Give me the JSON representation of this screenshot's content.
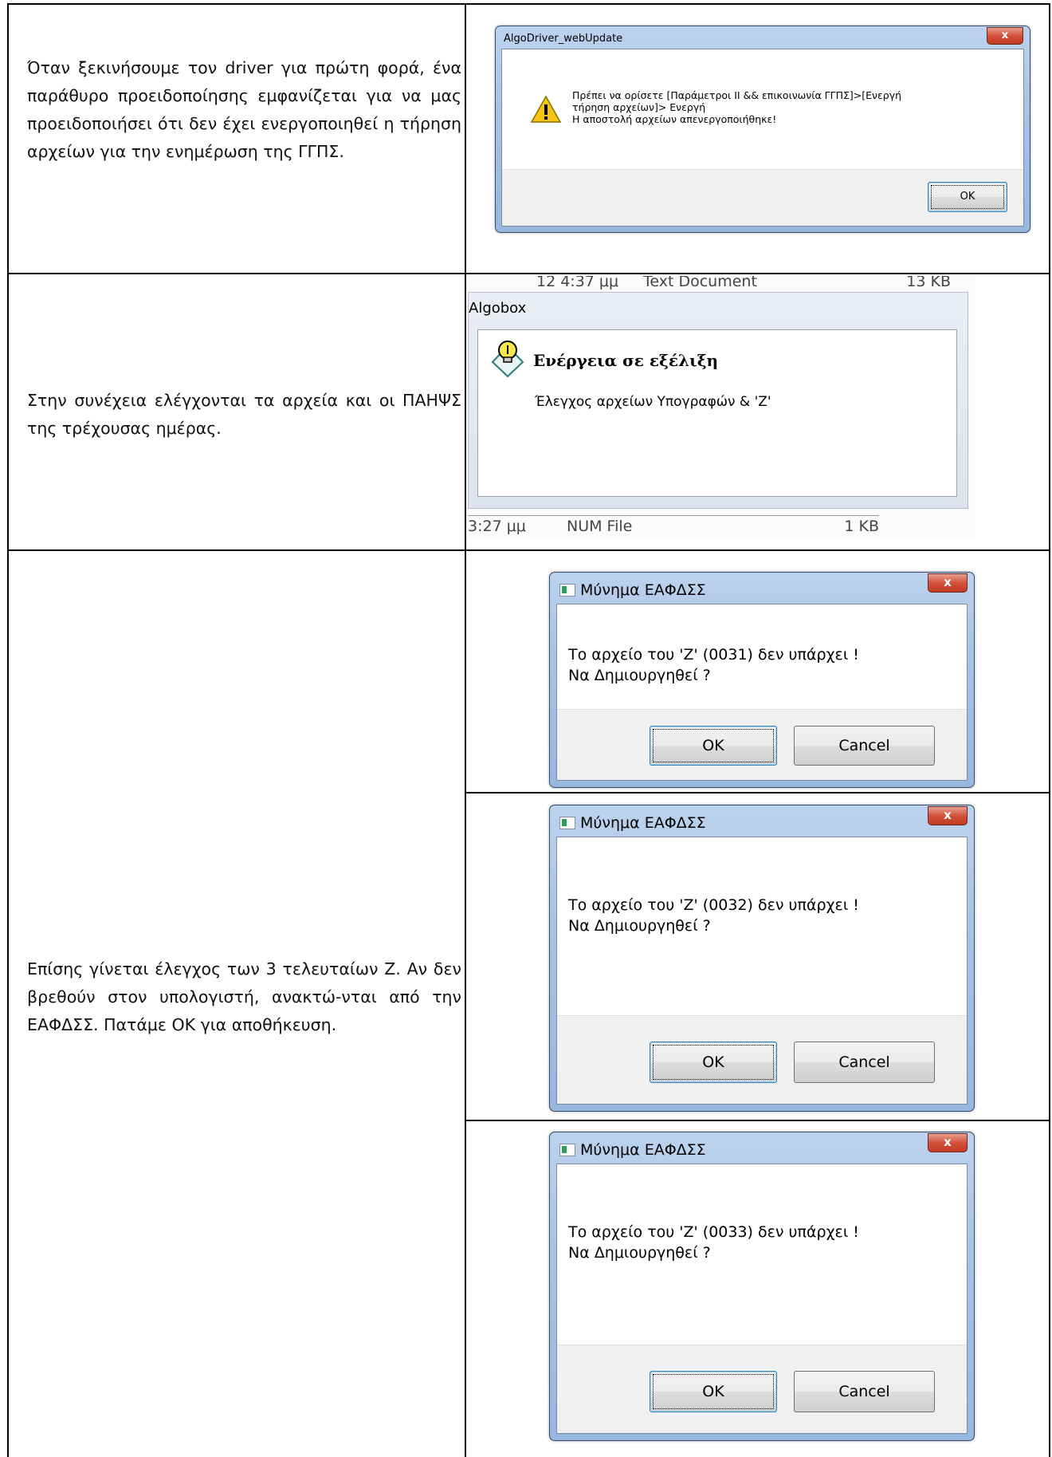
{
  "rows": [
    {
      "text": "Όταν ξεκινήσουμε τον driver για πρώτη φορά, ένα παράθυρο προειδοποίησης εμφανίζεται για να μας προειδοποιήσει ότι δεν έχει ενεργοποιηθεί η τήρηση αρχείων για την ενημέρωση της ΓΓΠΣ."
    },
    {
      "text": "Στην συνέχεια ελέγχονται τα αρχεία και οι ΠΑΗΨΣ της τρέχουσας ημέρας."
    },
    {
      "text": "Επίσης γίνεται έλεγχος των 3 τελευταίων Ζ. Αν δεν βρεθούν στον υπολογιστή, ανακτώ-νται από την ΕΑΦΔΣΣ. Πατάμε ΟΚ για αποθήκευση."
    }
  ],
  "warning_dialog": {
    "title": "AlgoDriver_webUpdate",
    "message_line1": "Πρέπει να ορίσετε [Παράμετροι ΙΙ && επικοινωνία ΓΓΠΣ]>[Ενεργή",
    "message_line2": "τήρηση αρχείων]> Ενεργή",
    "message_line3": "Η αποστολή αρχείων απενεργοποιήθηκε!",
    "ok_label": "OK",
    "close_label": "x"
  },
  "algobox": {
    "top_time": "12 4:37 μμ",
    "top_type": "Text Document",
    "top_size": "13 KB",
    "title": "Algobox",
    "heading": "Ενέργεια σε εξέλιξη",
    "message": "Έλεγχος αρχείων Υπογραφών & 'Ζ'",
    "bottom_time": "3:27 μμ",
    "bottom_type": "NUM File",
    "bottom_size": "1 KB"
  },
  "z_dialogs": [
    {
      "title": "Μύνημα ΕΑΦΔΣΣ",
      "line1": "Το αρχείο του 'Ζ' (0031) δεν υπάρχει !",
      "line2": "Να Δημιουργηθεί ?",
      "ok_label": "OK",
      "cancel_label": "Cancel",
      "close_label": "x"
    },
    {
      "title": "Μύνημα ΕΑΦΔΣΣ",
      "line1": "Το αρχείο του 'Ζ' (0032) δεν υπάρχει !",
      "line2": "Να Δημιουργηθεί ?",
      "ok_label": "OK",
      "cancel_label": "Cancel",
      "close_label": "x"
    },
    {
      "title": "Μύνημα ΕΑΦΔΣΣ",
      "line1": "Το αρχείο του 'Ζ' (0033) δεν υπάρχει !",
      "line2": "Να Δημιουργηθεί ?",
      "ok_label": "OK",
      "cancel_label": "Cancel",
      "close_label": "x"
    }
  ]
}
